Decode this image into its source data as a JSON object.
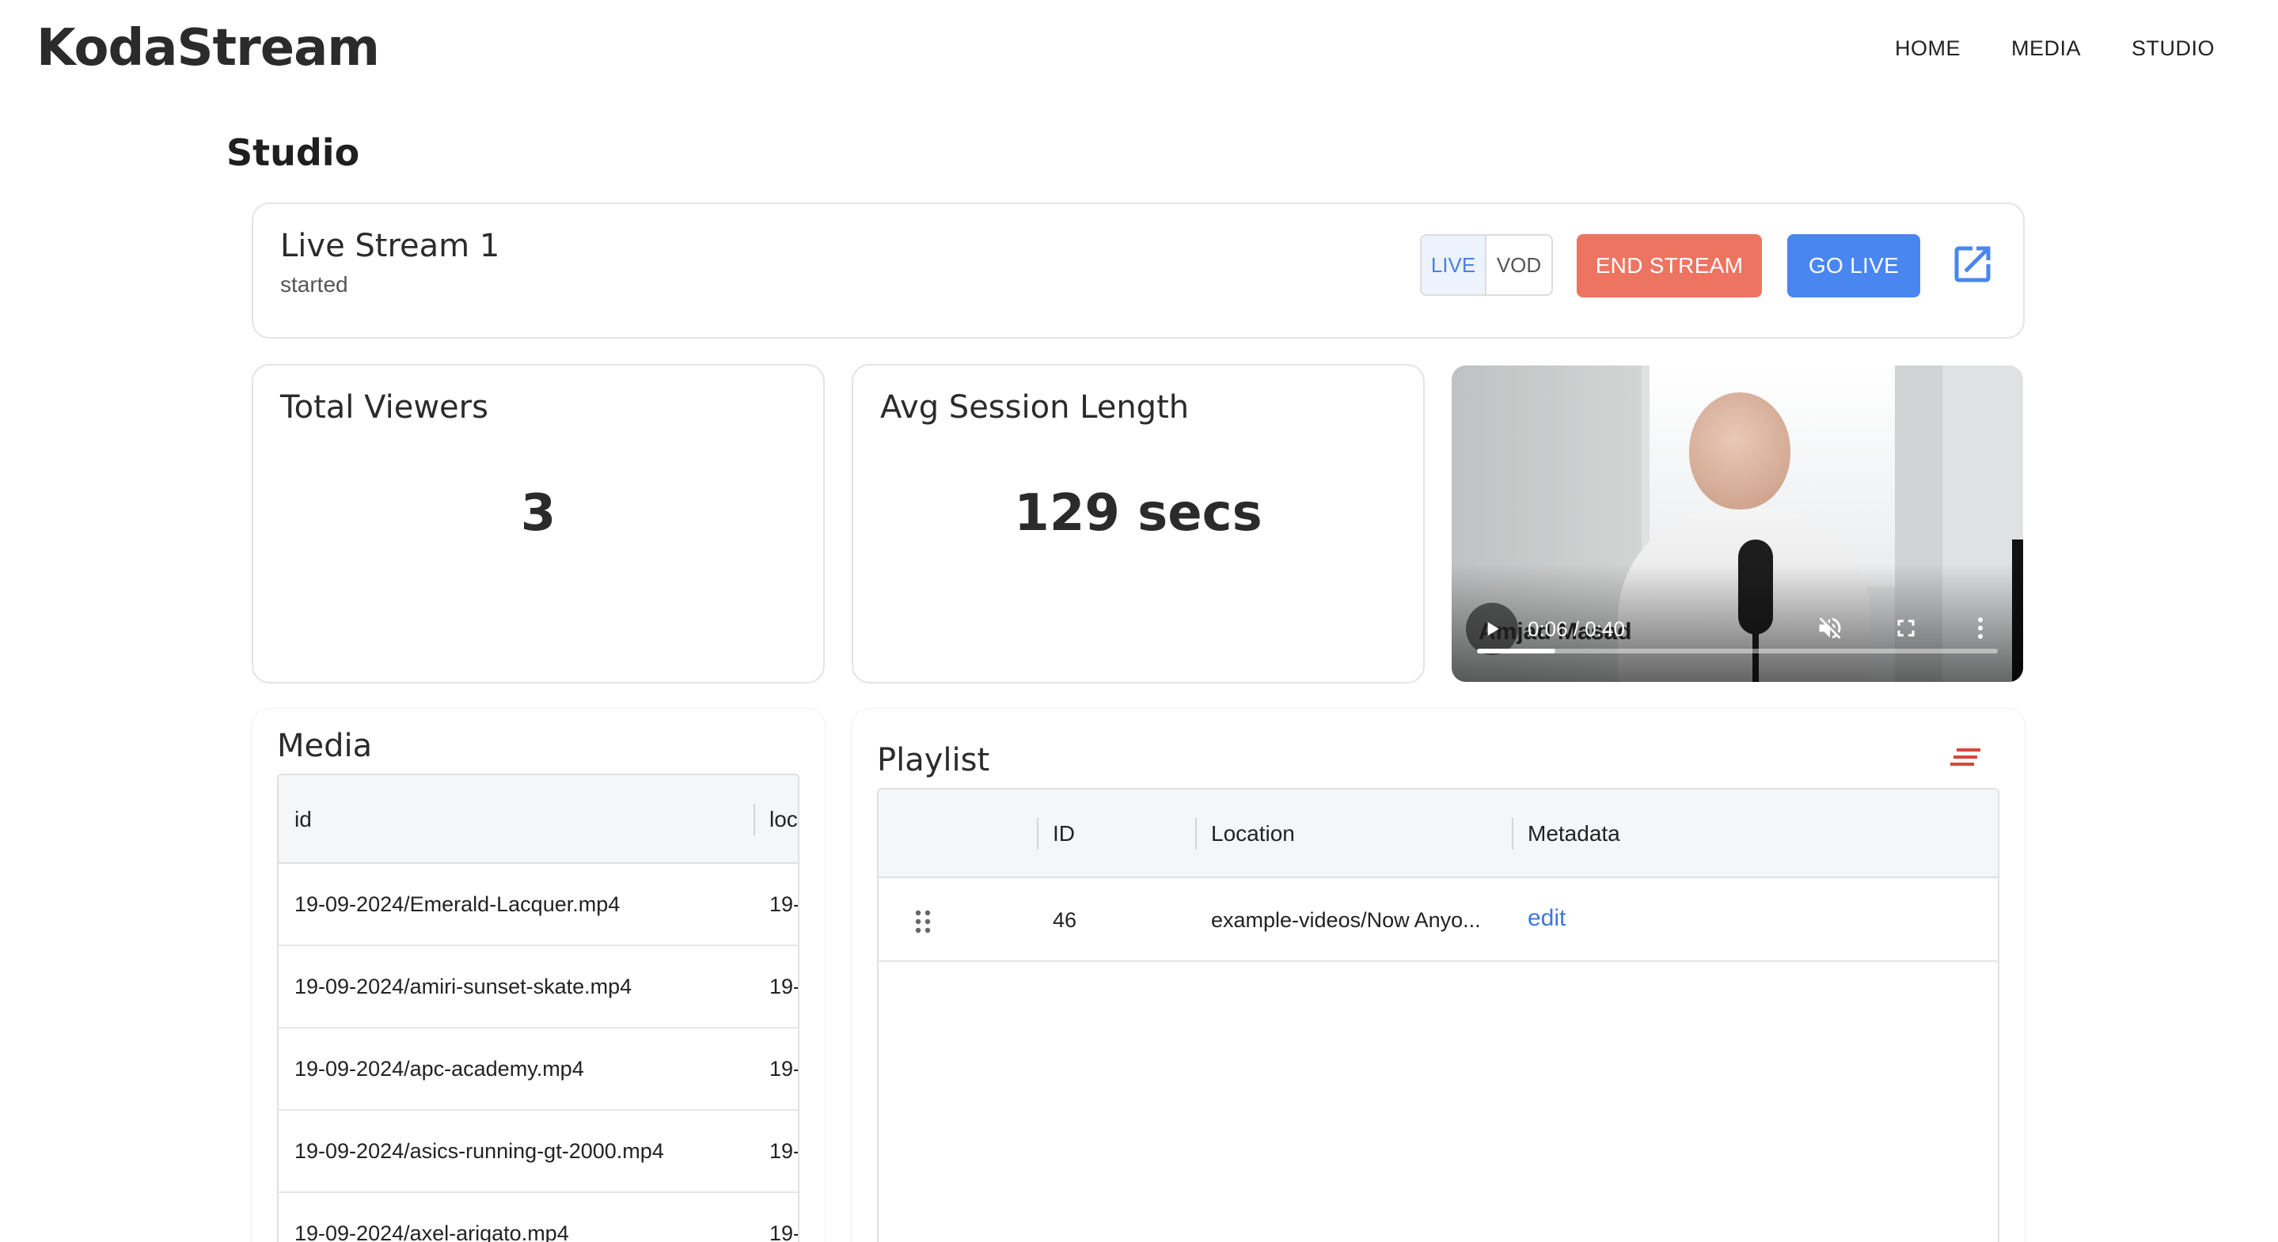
{
  "app": {
    "brand": "KodaStream"
  },
  "nav": {
    "home": "HOME",
    "media": "MEDIA",
    "studio": "STUDIO"
  },
  "page": {
    "title": "Studio"
  },
  "stream": {
    "name": "Live Stream 1",
    "status": "started",
    "mode_live": "LIVE",
    "mode_vod": "VOD",
    "selected_mode": "LIVE",
    "end_label": "END STREAM",
    "go_live_label": "GO LIVE",
    "end_color": "#ee7462",
    "go_live_color": "#4a86f0"
  },
  "stats": {
    "viewers_title": "Total Viewers",
    "viewers_value": "3",
    "session_title": "Avg Session Length",
    "session_value": "129 secs"
  },
  "video": {
    "caption": "Amjad Masad",
    "time": "0:06 / 0:40",
    "progress": 0.15,
    "muted": true
  },
  "media": {
    "title": "Media",
    "columns": [
      "id",
      "loc"
    ],
    "rows": [
      {
        "id": "19-09-2024/Emerald-Lacquer.mp4",
        "loc": "19-"
      },
      {
        "id": "19-09-2024/amiri-sunset-skate.mp4",
        "loc": "19-"
      },
      {
        "id": "19-09-2024/apc-academy.mp4",
        "loc": "19-"
      },
      {
        "id": "19-09-2024/asics-running-gt-2000.mp4",
        "loc": "19-"
      },
      {
        "id": "19-09-2024/axel-arigato.mp4",
        "loc": "19-"
      }
    ]
  },
  "playlist": {
    "title": "Playlist",
    "columns": [
      "ID",
      "Location",
      "Metadata"
    ],
    "rows": [
      {
        "id": "46",
        "location": "example-videos/Now Anyo...",
        "metadata": "edit"
      }
    ]
  },
  "icons": {
    "external_link": "open-in-new-icon",
    "sort": "sort-icon",
    "drag": "drag-handle-icon"
  }
}
